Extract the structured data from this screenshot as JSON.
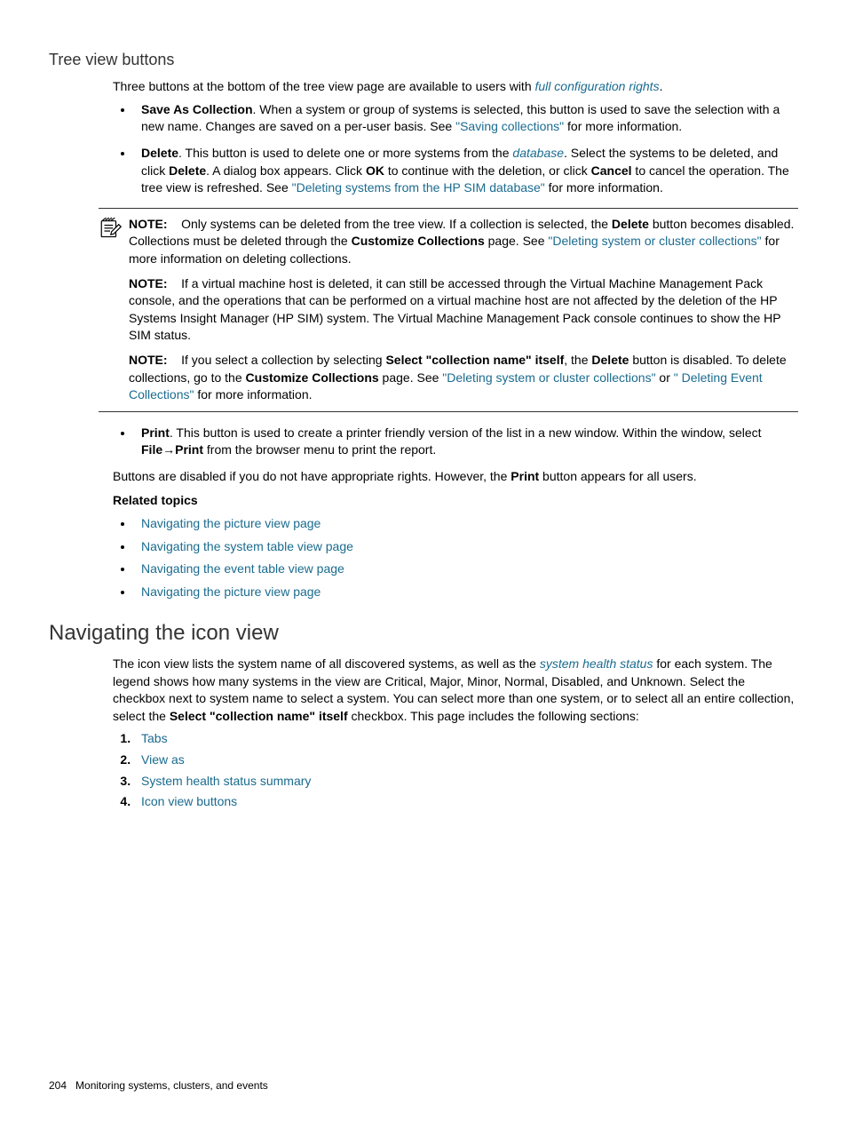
{
  "section1": {
    "heading": "Tree view buttons",
    "intro_a": "Three buttons at the bottom of the tree view page are available to users with ",
    "intro_link": "full configuration rights",
    "intro_b": ".",
    "bullets": [
      {
        "lead": "Save As Collection",
        "tail_a": ". When a system or group of systems is selected, this button is used to save the selection with a new name. Changes are saved on a per-user basis. See ",
        "link1": "\"Saving collections\"",
        "tail_b": " for more information."
      },
      {
        "lead": "Delete",
        "tail_a": ". This button is used to delete one or more systems from the ",
        "italic1": "database",
        "tail_b": ". Select the systems to be deleted, and click ",
        "bold1": "Delete",
        "tail_c": ". A dialog box appears. Click ",
        "bold2": "OK",
        "tail_d": " to continue with the deletion, or click ",
        "bold3": "Cancel",
        "tail_e": " to cancel the operation. The tree view is refreshed. See ",
        "link1": "\"Deleting systems from the HP SIM database\"",
        "tail_f": " for more information."
      }
    ],
    "notes": [
      {
        "label": "NOTE:",
        "pre": "Only systems can be deleted from the tree view. If a collection is selected, the ",
        "bold1": "Delete",
        "mid1": " button becomes disabled. Collections must be deleted through the ",
        "bold2": "Customize Collections",
        "mid2": " page. See ",
        "link1": "\"Deleting system or cluster collections\"",
        "tail": " for more information on deleting collections."
      },
      {
        "label": "NOTE:",
        "text": "If a virtual machine host is deleted, it can still be accessed through the Virtual Machine Management Pack console, and the operations that can be performed on a virtual machine host are not affected by the deletion of the HP Systems Insight Manager (HP SIM) system. The Virtual Machine Management Pack console continues to show the HP SIM status."
      },
      {
        "label": "NOTE:",
        "pre": "If you select a collection by selecting ",
        "bold1": "Select \"collection name\" itself",
        "mid1": ", the ",
        "bold2": "Delete",
        "mid2": " button is disabled. To delete collections, go to the ",
        "bold3": "Customize Collections",
        "mid3": " page. See ",
        "link1": "\"Deleting system or cluster collections\"",
        "mid4": " or ",
        "link2": "\" Deleting Event Collections\"",
        "tail": " for more information."
      }
    ],
    "print_bullet": {
      "lead": "Print",
      "tail_a": ". This button is used to create a printer friendly version of the list in a new window. Within the window, select ",
      "bold1": "File",
      "arrow": "→",
      "bold2": "Print",
      "tail_b": " from the browser menu to print the report."
    },
    "after_print": {
      "a": "Buttons are disabled if you do not have appropriate rights. However, the ",
      "bold": "Print",
      "b": " button appears for all users."
    },
    "related_heading": "Related topics",
    "related_links": [
      "Navigating the picture view page",
      "Navigating the system table view page",
      "Navigating the event table view page",
      "Navigating the picture view page"
    ]
  },
  "section2": {
    "heading": "Navigating the icon view",
    "intro_a": "The icon view lists the system name of all discovered systems, as well as the ",
    "intro_link": "system health status",
    "intro_b": " for each system. The legend shows how many systems in the view are Critical, Major, Minor, Normal, Disabled, and Unknown. Select the checkbox next to system name to select a system. You can select more than one system, or to select all an entire collection, select the ",
    "intro_bold": "Select \"collection name\" itself",
    "intro_c": " checkbox. This page includes the following sections:",
    "list": [
      "Tabs",
      "View as",
      "System health status summary",
      "Icon view buttons"
    ]
  },
  "footer": {
    "page": "204",
    "title": "Monitoring systems, clusters, and events"
  }
}
